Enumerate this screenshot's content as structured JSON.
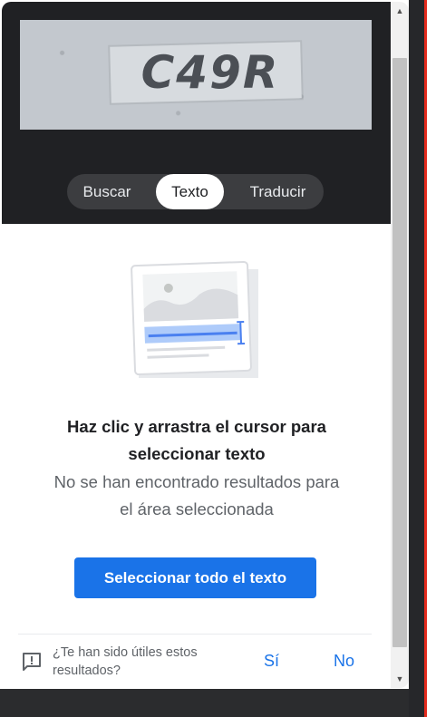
{
  "image_preview": {
    "plate_text": "C49R"
  },
  "tabs": [
    {
      "label": "Buscar",
      "selected": false
    },
    {
      "label": "Texto",
      "selected": true
    },
    {
      "label": "Traducir",
      "selected": false
    }
  ],
  "empty_state": {
    "headline_line1": "Haz clic y arrastra el cursor para",
    "headline_line2": "seleccionar texto",
    "subtext_line1": "No se han encontrado resultados para",
    "subtext_line2": "el área seleccionada"
  },
  "actions": {
    "select_all_label": "Seleccionar todo el texto"
  },
  "feedback": {
    "question_line1": "¿Te han sido útiles estos",
    "question_line2": "resultados?",
    "yes_label": "Sí",
    "no_label": "No"
  },
  "colors": {
    "accent": "#1a73e8",
    "panel_dark": "#202124",
    "tab_bg": "#3c3d40",
    "red_edge": "#e32b1d"
  },
  "icons": {
    "feedback": "feedback-icon",
    "scroll_up": "scroll-up-arrow-icon",
    "scroll_down": "scroll-down-arrow-icon",
    "illustration": "text-selection-illustration"
  }
}
